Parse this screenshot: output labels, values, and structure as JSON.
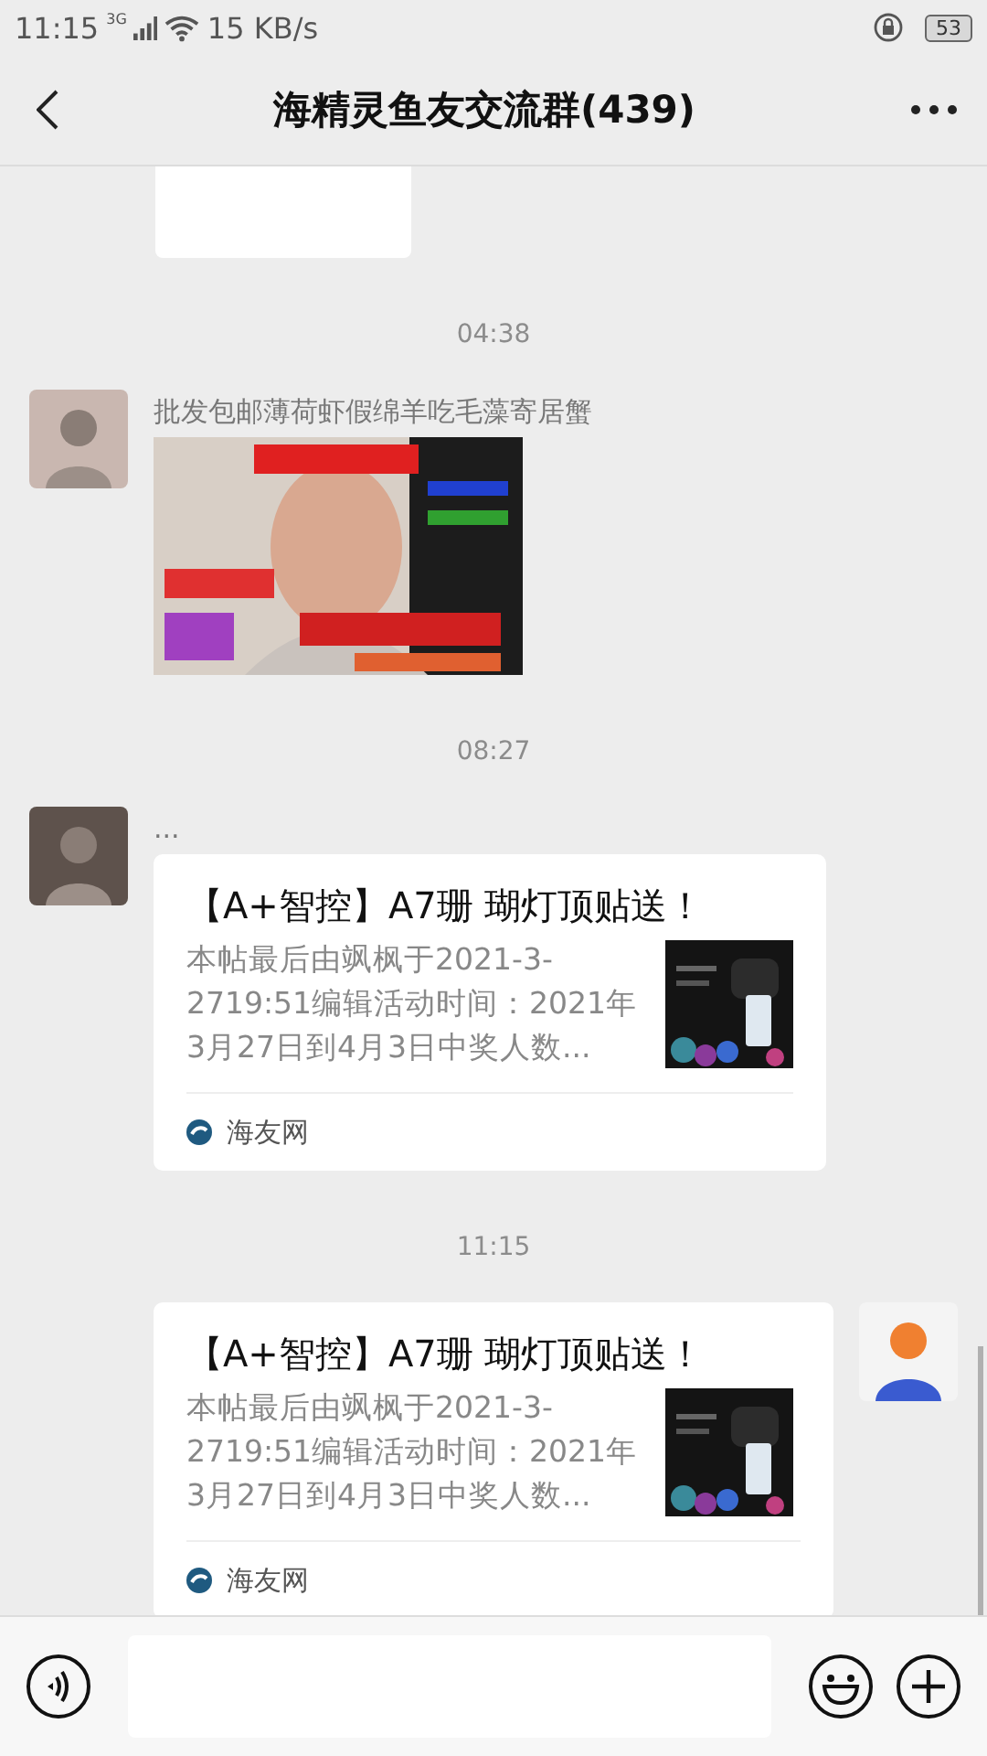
{
  "status_bar": {
    "time": "11:15",
    "network": "3G",
    "speed": "15 KB/s",
    "battery": "53"
  },
  "header": {
    "title": "海精灵鱼友交流群(439)"
  },
  "messages": [
    {
      "kind": "partial_card"
    },
    {
      "kind": "time",
      "text": "04:38"
    },
    {
      "outgoing": false,
      "sender": "批发包邮薄荷虾假绵羊吃毛藻寄居蟹"
    },
    {
      "kind": "time",
      "text": "08:27"
    },
    {
      "kind": "link",
      "outgoing": false,
      "sender": "...",
      "title": "【A+智控】A7珊 瑚灯顶贴送！",
      "description": "本帖最后由飒枫于2021-3-2719:51编辑活动时间：2021年3月27日到4月3日中奖人数...",
      "source": "海友网"
    },
    {
      "kind": "time",
      "text": "11:15"
    },
    {
      "kind": "link",
      "outgoing": true,
      "title": "【A+智控】A7珊 瑚灯顶贴送！",
      "description": "本帖最后由飒枫于2021-3-2719:51编辑活动时间：2021年3月27日到4月3日中奖人数...",
      "source": "海友网"
    }
  ]
}
